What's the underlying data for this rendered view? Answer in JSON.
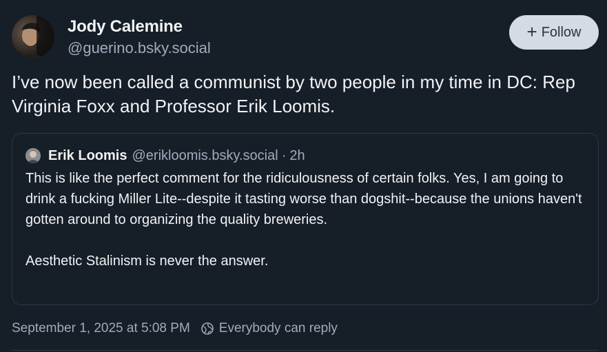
{
  "author": {
    "display_name": "Jody Calemine",
    "handle": "@guerino.bsky.social"
  },
  "follow_button": {
    "icon": "plus-icon",
    "label": "Follow"
  },
  "post": {
    "text": "I’ve now been called a communist by two people in my time in DC: Rep Virginia Foxx and Professor Erik Loomis."
  },
  "quote": {
    "display_name": "Erik Loomis",
    "handle": "@erikloomis.bsky.social",
    "separator": "·",
    "time": "2h",
    "text": "This is like the perfect comment for the ridiculousness of certain folks. Yes, I am going to drink a fucking Miller Lite--despite it tasting worse than dogshit--because the unions haven't gotten around to organizing the quality breweries.\n\nAesthetic Stalinism is never the answer."
  },
  "meta": {
    "timestamp": "September 1, 2025 at 5:08 PM",
    "reply_icon": "globe-reply-icon",
    "reply_setting": "Everybody can reply"
  },
  "colors": {
    "background": "#161e27",
    "text": "#f1f3f5",
    "muted": "#9fadbc",
    "border": "#2e3845",
    "follow_bg": "#d4dbe2"
  }
}
